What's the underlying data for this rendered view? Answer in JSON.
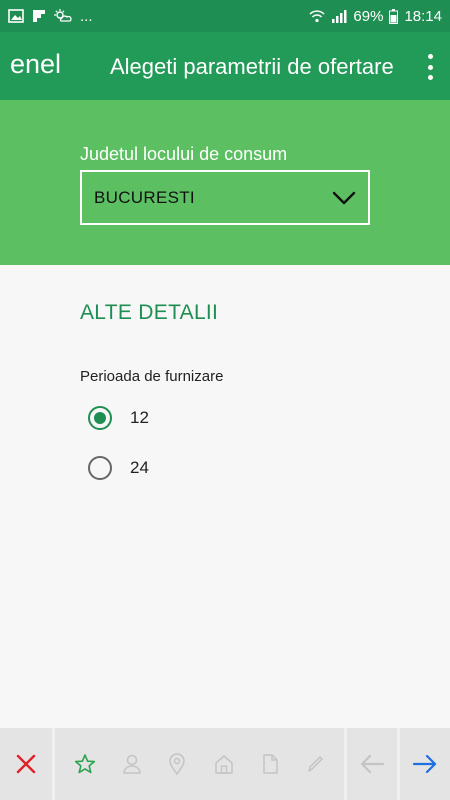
{
  "status_bar": {
    "dots": "...",
    "battery_percent": "69%",
    "time": "18:14"
  },
  "app_bar": {
    "logo": "enel",
    "title": "Alegeti parametrii de ofertare"
  },
  "county": {
    "label": "Judetul locului de consum",
    "selected_value": "BUCURESTI"
  },
  "details": {
    "section_title": "ALTE DETALII",
    "period_label": "Perioada de furnizare",
    "options": [
      {
        "label": "12",
        "selected": true
      },
      {
        "label": "24",
        "selected": false
      }
    ]
  },
  "bottom_bar": {
    "step_icons": [
      "star-icon",
      "user-icon",
      "location-pin-icon",
      "home-icon",
      "document-icon",
      "pencil-icon"
    ],
    "colors": {
      "close": "#e0202a",
      "star": "#2aa34e",
      "inactive": "#c4c4c4",
      "next": "#1e6fe0"
    }
  },
  "colors": {
    "status_bar": "#1f8e52",
    "app_bar": "#229a58",
    "panel": "#5cc062",
    "accent": "#1f8e52"
  }
}
